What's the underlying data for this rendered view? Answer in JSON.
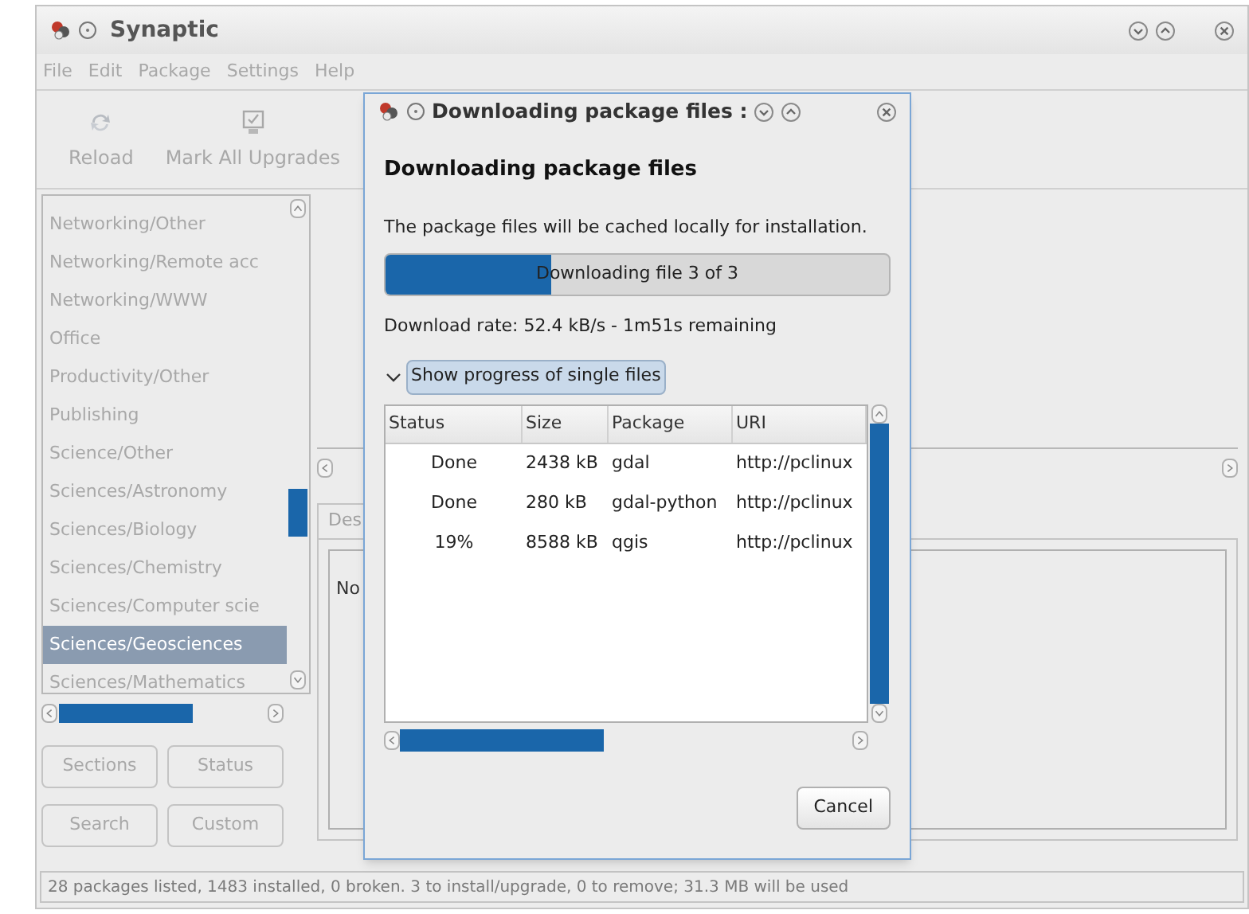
{
  "main_window": {
    "title": "Synaptic",
    "menu": [
      "File",
      "Edit",
      "Package",
      "Settings",
      "Help"
    ],
    "toolbar": [
      {
        "label": "Reload",
        "kind": "reload"
      },
      {
        "label": "Mark All Upgrades",
        "kind": "upgrade"
      }
    ],
    "sections": [
      {
        "label": "Networking/Other",
        "selected": false
      },
      {
        "label": "Networking/Remote acc",
        "selected": false
      },
      {
        "label": "Networking/WWW",
        "selected": false
      },
      {
        "label": "Office",
        "selected": false
      },
      {
        "label": "Productivity/Other",
        "selected": false
      },
      {
        "label": "Publishing",
        "selected": false
      },
      {
        "label": "Science/Other",
        "selected": false
      },
      {
        "label": "Sciences/Astronomy",
        "selected": false
      },
      {
        "label": "Sciences/Biology",
        "selected": false
      },
      {
        "label": "Sciences/Chemistry",
        "selected": false
      },
      {
        "label": "Sciences/Computer scie",
        "selected": false
      },
      {
        "label": "Sciences/Geosciences",
        "selected": true
      },
      {
        "label": "Sciences/Mathematics",
        "selected": false
      }
    ],
    "filter_buttons": [
      "Sections",
      "Status",
      "Search",
      "Custom"
    ],
    "details_tab": "Des",
    "details_text": "No",
    "status_bar": "28 packages listed, 1483 installed, 0 broken. 3 to install/upgrade, 0 to remove; 31.3 MB will be used"
  },
  "dialog": {
    "title": "Downloading package files :",
    "heading": "Downloading package files",
    "description": "The package files will be cached locally for installation.",
    "progress": {
      "label": "Downloading file 3 of 3",
      "level": 0.33
    },
    "rate": "Download rate: 52.4 kB/s - 1m51s remaining",
    "expander": {
      "label": "Show progress of single files",
      "expanded": true
    },
    "table": {
      "columns": [
        "Status",
        "Size",
        "Package",
        "URI"
      ],
      "rows": [
        {
          "status": "Done",
          "size": "2438 kB",
          "package": "gdal",
          "uri": "http://pclinux"
        },
        {
          "status": "Done",
          "size": "280 kB",
          "package": "gdal-python",
          "uri": "http://pclinux"
        },
        {
          "status": "19%",
          "size": "8588 kB",
          "package": "qgis",
          "uri": "http://pclinux"
        }
      ]
    },
    "cancel": "Cancel"
  }
}
